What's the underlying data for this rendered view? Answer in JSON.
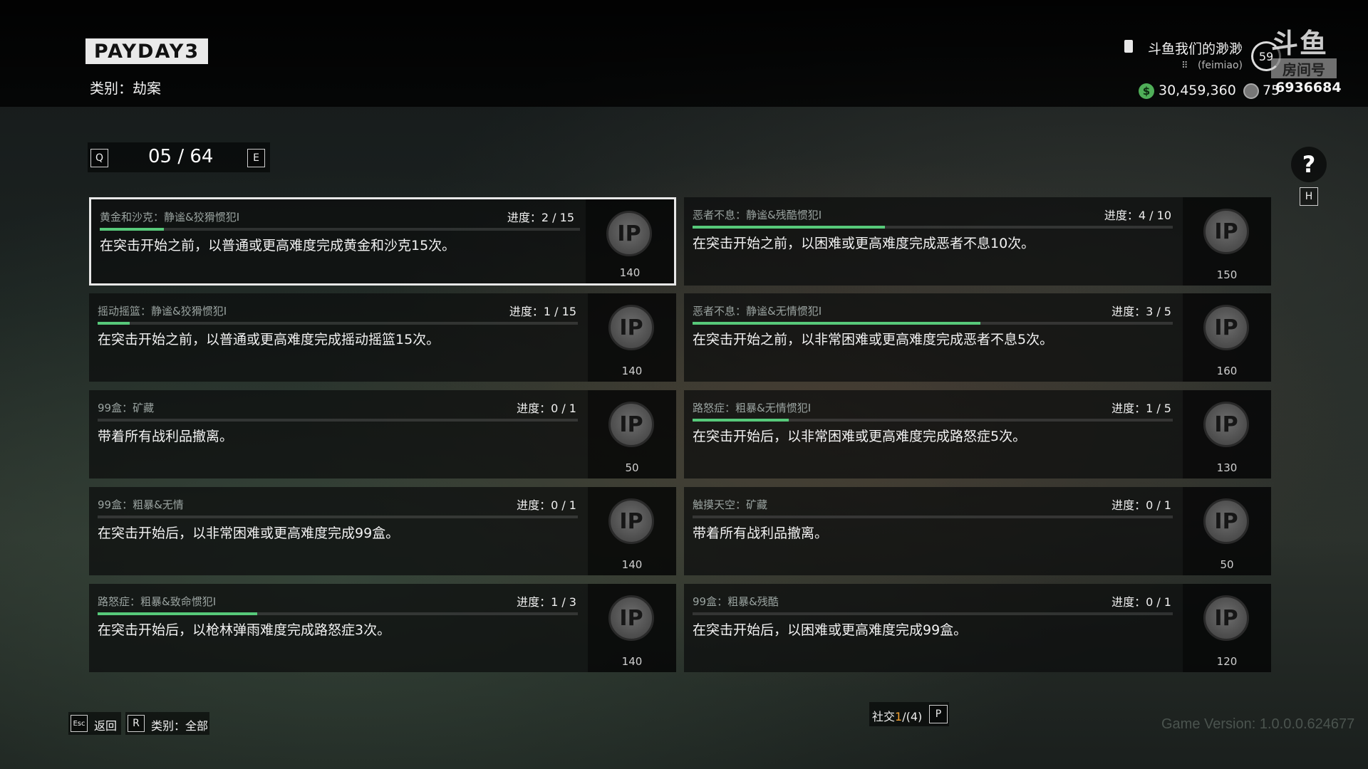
{
  "header": {
    "logo_text": "PAYDAY3",
    "category_title": "类别：劫案"
  },
  "user": {
    "name": "斗鱼我们的渺渺",
    "sub": "(feimiao)",
    "level": "59",
    "money": "30,459,360",
    "tokens": "75"
  },
  "watermark": {
    "brand": "斗鱼",
    "room_label": "房间号",
    "room_number": "6936684"
  },
  "pager": {
    "prev_key": "Q",
    "page": "05 / 64",
    "next_key": "E"
  },
  "help": {
    "symbol": "?",
    "key": "H"
  },
  "cards": [
    {
      "name": "黄金和沙克：静谧&狡猾惯犯I",
      "progress": "进度：2 / 15",
      "fraction": 0.133,
      "description": "在突击开始之前，以普通或更高难度完成黄金和沙克15次。",
      "badge": "IP",
      "reward": "140",
      "selected": true
    },
    {
      "name": "恶者不息：静谧&残酷惯犯I",
      "progress": "进度：4 / 10",
      "fraction": 0.4,
      "description": "在突击开始之前，以困难或更高难度完成恶者不息10次。",
      "badge": "IP",
      "reward": "150",
      "selected": false
    },
    {
      "name": "摇动摇篮：静谧&狡猾惯犯I",
      "progress": "进度：1 / 15",
      "fraction": 0.067,
      "description": "在突击开始之前，以普通或更高难度完成摇动摇篮15次。",
      "badge": "IP",
      "reward": "140",
      "selected": false
    },
    {
      "name": "恶者不息：静谧&无情惯犯I",
      "progress": "进度：3 / 5",
      "fraction": 0.6,
      "description": "在突击开始之前，以非常困难或更高难度完成恶者不息5次。",
      "badge": "IP",
      "reward": "160",
      "selected": false
    },
    {
      "name": "99盒：矿藏",
      "progress": "进度：0 / 1",
      "fraction": 0,
      "description": "带着所有战利品撤离。",
      "badge": "IP",
      "reward": "50",
      "selected": false
    },
    {
      "name": "路怒症：粗暴&无情惯犯I",
      "progress": "进度：1 / 5",
      "fraction": 0.2,
      "description": "在突击开始后，以非常困难或更高难度完成路怒症5次。",
      "badge": "IP",
      "reward": "130",
      "selected": false
    },
    {
      "name": "99盒：粗暴&无情",
      "progress": "进度：0 / 1",
      "fraction": 0,
      "description": "在突击开始后，以非常困难或更高难度完成99盒。",
      "badge": "IP",
      "reward": "140",
      "selected": false
    },
    {
      "name": "触摸天空：矿藏",
      "progress": "进度：0 / 1",
      "fraction": 0,
      "description": "带着所有战利品撤离。",
      "badge": "IP",
      "reward": "50",
      "selected": false
    },
    {
      "name": "路怒症：粗暴&致命惯犯I",
      "progress": "进度：1 / 3",
      "fraction": 0.333,
      "description": "在突击开始后，以枪林弹雨难度完成路怒症3次。",
      "badge": "IP",
      "reward": "140",
      "selected": false
    },
    {
      "name": "99盒：粗暴&残酷",
      "progress": "进度：0 / 1",
      "fraction": 0,
      "description": "在突击开始后，以困难或更高难度完成99盒。",
      "badge": "IP",
      "reward": "120",
      "selected": false
    }
  ],
  "footer": {
    "back_key": "Esc",
    "back_label": "返回",
    "category_key": "R",
    "category_label": "类别：全部",
    "social_prefix": "社交",
    "social_count": "1",
    "social_suffix": "/(4)",
    "social_key": "P",
    "version": "Game Version: 1.0.0.0.624677"
  },
  "colors": {
    "progress_fill": "#57c97a",
    "selected_border": "#e8e8e8",
    "money_icon": "#4fae58",
    "social_count": "#f0a030"
  }
}
